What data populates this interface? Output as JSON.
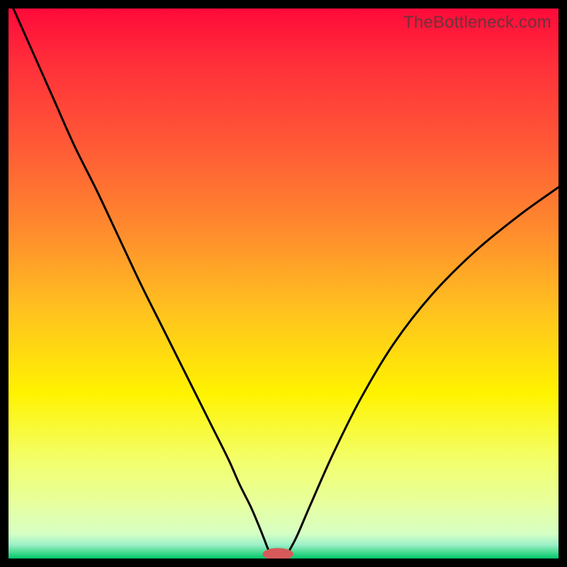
{
  "watermark": "TheBottleneck.com",
  "chart_data": {
    "type": "line",
    "title": "",
    "xlabel": "",
    "ylabel": "",
    "xlim": [
      0,
      100
    ],
    "ylim": [
      0,
      100
    ],
    "gradient_stops": [
      {
        "offset": 0.0,
        "color": "#ff0a3a"
      },
      {
        "offset": 0.1,
        "color": "#ff2f3a"
      },
      {
        "offset": 0.25,
        "color": "#ff5a36"
      },
      {
        "offset": 0.4,
        "color": "#ff8a2e"
      },
      {
        "offset": 0.55,
        "color": "#ffc21f"
      },
      {
        "offset": 0.7,
        "color": "#fff300"
      },
      {
        "offset": 0.82,
        "color": "#f3ff6a"
      },
      {
        "offset": 0.9,
        "color": "#e7ff9e"
      },
      {
        "offset": 0.955,
        "color": "#d6ffc4"
      },
      {
        "offset": 0.975,
        "color": "#9cf0c8"
      },
      {
        "offset": 0.99,
        "color": "#3fd98c"
      },
      {
        "offset": 1.0,
        "color": "#00c66a"
      }
    ],
    "series": [
      {
        "name": "bottleneck-curve",
        "color": "#000000",
        "x": [
          0,
          4,
          8,
          12,
          16,
          20,
          24,
          28,
          31,
          34,
          37,
          40,
          42,
          44,
          45.5,
          46.5,
          47.2,
          47.8,
          50.5,
          51.2,
          52.5,
          55,
          59,
          64,
          70,
          77,
          85,
          93,
          100
        ],
        "y": [
          102,
          93,
          84,
          75,
          67,
          58.5,
          50,
          42,
          36,
          30,
          24,
          18,
          13.5,
          9.5,
          6.0,
          3.5,
          1.7,
          0.6,
          0.6,
          1.7,
          4.2,
          10,
          19,
          29,
          39,
          48,
          56,
          62.5,
          67.5
        ]
      }
    ],
    "marker": {
      "name": "bottleneck-minimum-marker",
      "cx": 49.0,
      "cy": 0.8,
      "rx": 2.8,
      "ry": 1.1,
      "color": "#d65a5a"
    }
  }
}
